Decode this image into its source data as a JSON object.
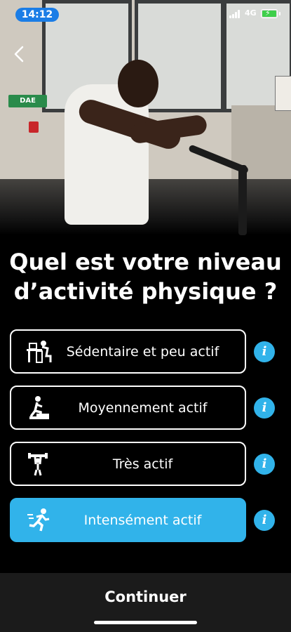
{
  "status_bar": {
    "time": "14:12",
    "network": "4G"
  },
  "hero": {
    "sign_text": "DAE"
  },
  "title": "Quel est votre niveau d’activité physique ?",
  "options": [
    {
      "label": "Sédentaire et peu actif",
      "icon": "desk-person-icon",
      "selected": false
    },
    {
      "label": "Moyennement actif",
      "icon": "person-climbing-icon",
      "selected": false
    },
    {
      "label": "Très actif",
      "icon": "person-lifting-icon",
      "selected": false
    },
    {
      "label": "Intensément actif",
      "icon": "person-running-icon",
      "selected": true
    }
  ],
  "info_glyph": "i",
  "continue_label": "Continuer",
  "colors": {
    "accent": "#31b3ea",
    "background": "#000000",
    "bottom_bar": "#1b1b1b"
  }
}
